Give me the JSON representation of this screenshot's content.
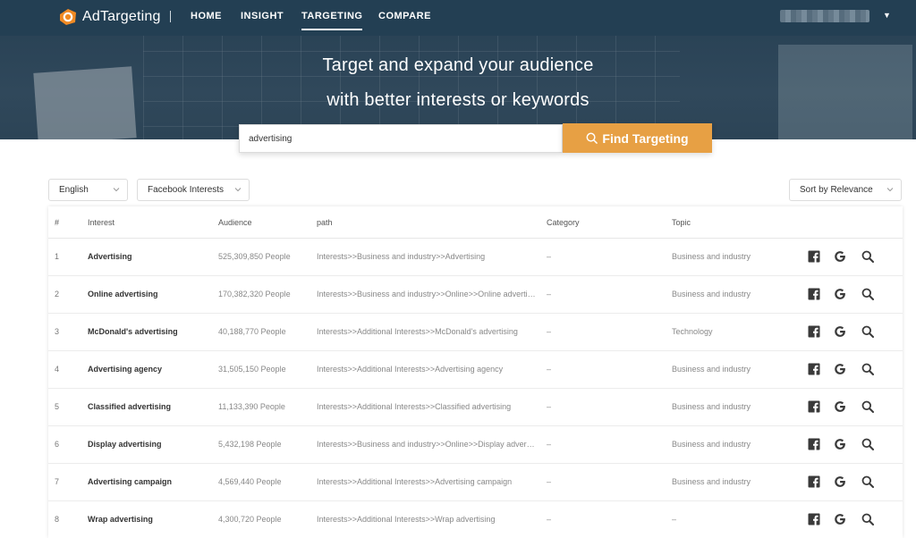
{
  "brand": {
    "name": "AdTargeting"
  },
  "nav": [
    {
      "label": "HOME",
      "active": false
    },
    {
      "label": "INSIGHT",
      "active": false
    },
    {
      "label": "TARGETING",
      "active": true
    },
    {
      "label": "COMPARE",
      "active": false
    }
  ],
  "user": {
    "caret": "▼"
  },
  "hero": {
    "line1": "Target and expand your audience",
    "line2": "with better interests or keywords"
  },
  "search": {
    "value": "advertising",
    "button_label": "Find Targeting",
    "icon": "search-icon"
  },
  "filters": {
    "language": "English",
    "source": "Facebook Interests",
    "sort": "Sort by Relevance"
  },
  "table": {
    "headers": {
      "num": "#",
      "interest": "Interest",
      "audience": "Audience",
      "path": "path",
      "category": "Category",
      "topic": "Topic"
    },
    "rows": [
      {
        "num": "1",
        "interest": "Advertising",
        "audience": "525,309,850 People",
        "path": "Interests>>Business and industry>>Advertising",
        "category": "–",
        "topic": "Business and industry"
      },
      {
        "num": "2",
        "interest": "Online advertising",
        "audience": "170,382,320 People",
        "path": "Interests>>Business and industry>>Online>>Online advertising",
        "category": "–",
        "topic": "Business and industry"
      },
      {
        "num": "3",
        "interest": "McDonald's advertising",
        "audience": "40,188,770 People",
        "path": "Interests>>Additional Interests>>McDonald's advertising",
        "category": "–",
        "topic": "Technology"
      },
      {
        "num": "4",
        "interest": "Advertising agency",
        "audience": "31,505,150 People",
        "path": "Interests>>Additional Interests>>Advertising agency",
        "category": "–",
        "topic": "Business and industry"
      },
      {
        "num": "5",
        "interest": "Classified advertising",
        "audience": "11,133,390 People",
        "path": "Interests>>Additional Interests>>Classified advertising",
        "category": "–",
        "topic": "Business and industry"
      },
      {
        "num": "6",
        "interest": "Display advertising",
        "audience": "5,432,198 People",
        "path": "Interests>>Business and industry>>Online>>Display advertising",
        "category": "–",
        "topic": "Business and industry"
      },
      {
        "num": "7",
        "interest": "Advertising campaign",
        "audience": "4,569,440 People",
        "path": "Interests>>Additional Interests>>Advertising campaign",
        "category": "–",
        "topic": "Business and industry"
      },
      {
        "num": "8",
        "interest": "Wrap advertising",
        "audience": "4,300,720 People",
        "path": "Interests>>Additional Interests>>Wrap advertising",
        "category": "–",
        "topic": "–"
      }
    ],
    "row_actions": [
      "facebook-icon",
      "google-icon",
      "search-icon"
    ]
  },
  "colors": {
    "nav_bg": "#233f53",
    "accent": "#e7a044",
    "logo": "#f08a24"
  }
}
